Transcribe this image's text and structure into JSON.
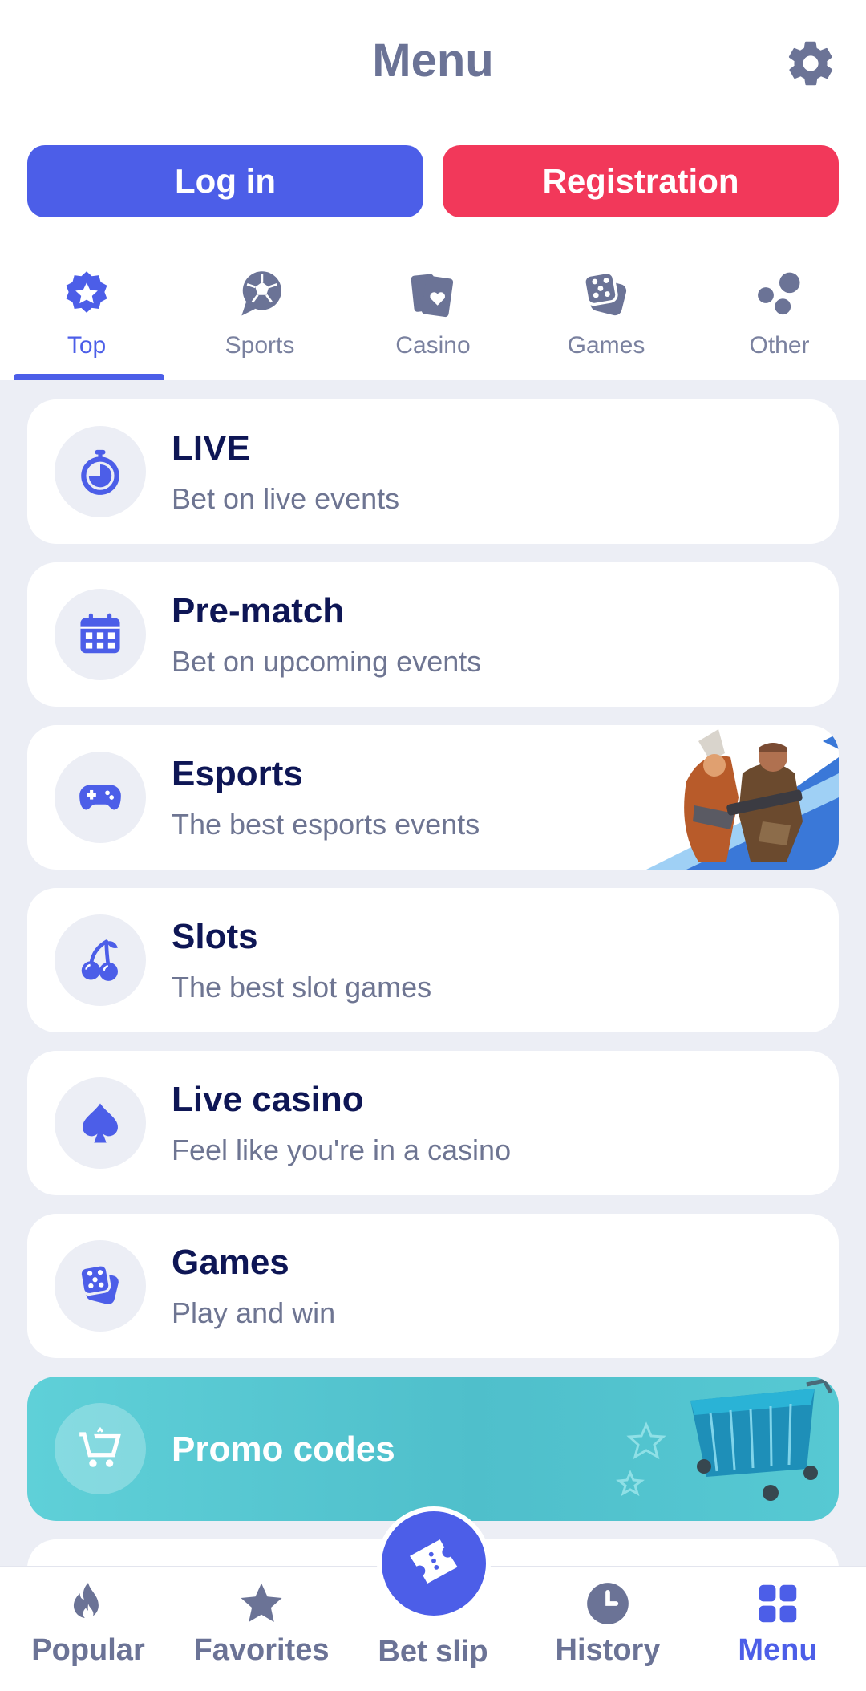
{
  "header": {
    "title": "Menu",
    "settings_icon": "gear-icon"
  },
  "auth": {
    "login_label": "Log in",
    "register_label": "Registration"
  },
  "tabs": [
    {
      "label": "Top",
      "icon": "star-badge-icon",
      "active": true
    },
    {
      "label": "Sports",
      "icon": "soccer-ball-icon",
      "active": false
    },
    {
      "label": "Casino",
      "icon": "playing-cards-icon",
      "active": false
    },
    {
      "label": "Games",
      "icon": "dice-icon",
      "active": false
    },
    {
      "label": "Other",
      "icon": "dots-icon",
      "active": false
    }
  ],
  "items": [
    {
      "title": "LIVE",
      "subtitle": "Bet on live events",
      "icon": "stopwatch-icon"
    },
    {
      "title": "Pre-match",
      "subtitle": "Bet on upcoming events",
      "icon": "calendar-icon"
    },
    {
      "title": "Esports",
      "subtitle": "The best esports events",
      "icon": "gamepad-icon"
    },
    {
      "title": "Slots",
      "subtitle": "The best slot games",
      "icon": "cherries-icon"
    },
    {
      "title": "Live casino",
      "subtitle": "Feel like you're in a casino",
      "icon": "spade-icon"
    },
    {
      "title": "Games",
      "subtitle": "Play and win",
      "icon": "dice-icon"
    }
  ],
  "promo": {
    "title": "Promo codes",
    "icon": "shopping-cart-icon"
  },
  "bottom_nav": [
    {
      "label": "Popular",
      "icon": "flame-icon",
      "active": false
    },
    {
      "label": "Favorites",
      "icon": "star-icon",
      "active": false
    },
    {
      "label": "Bet slip",
      "icon": "ticket-icon",
      "active": false
    },
    {
      "label": "History",
      "icon": "clock-icon",
      "active": false
    },
    {
      "label": "Menu",
      "icon": "grid-icon",
      "active": true
    }
  ],
  "colors": {
    "primary": "#4c5ee8",
    "registration": "#f2385a",
    "promo": "#4fbfcb",
    "title_text": "#0e1655",
    "muted_text": "#6e7592",
    "background": "#eceef5"
  }
}
